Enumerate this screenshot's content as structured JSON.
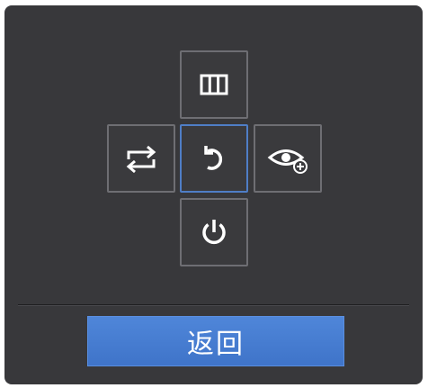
{
  "dpad": {
    "up_icon": "grid-columns-icon",
    "left_icon": "switch-arrows-icon",
    "center_icon": "undo-icon",
    "right_icon": "eye-plus-icon",
    "down_icon": "power-icon",
    "selected": "center"
  },
  "footer": {
    "back_label": "返回"
  },
  "colors": {
    "panel": "#38383b",
    "tile_border": "#6e6e73",
    "selected_border": "#4f7ec6",
    "button": "#4a80d4",
    "icon": "#ffffff"
  }
}
